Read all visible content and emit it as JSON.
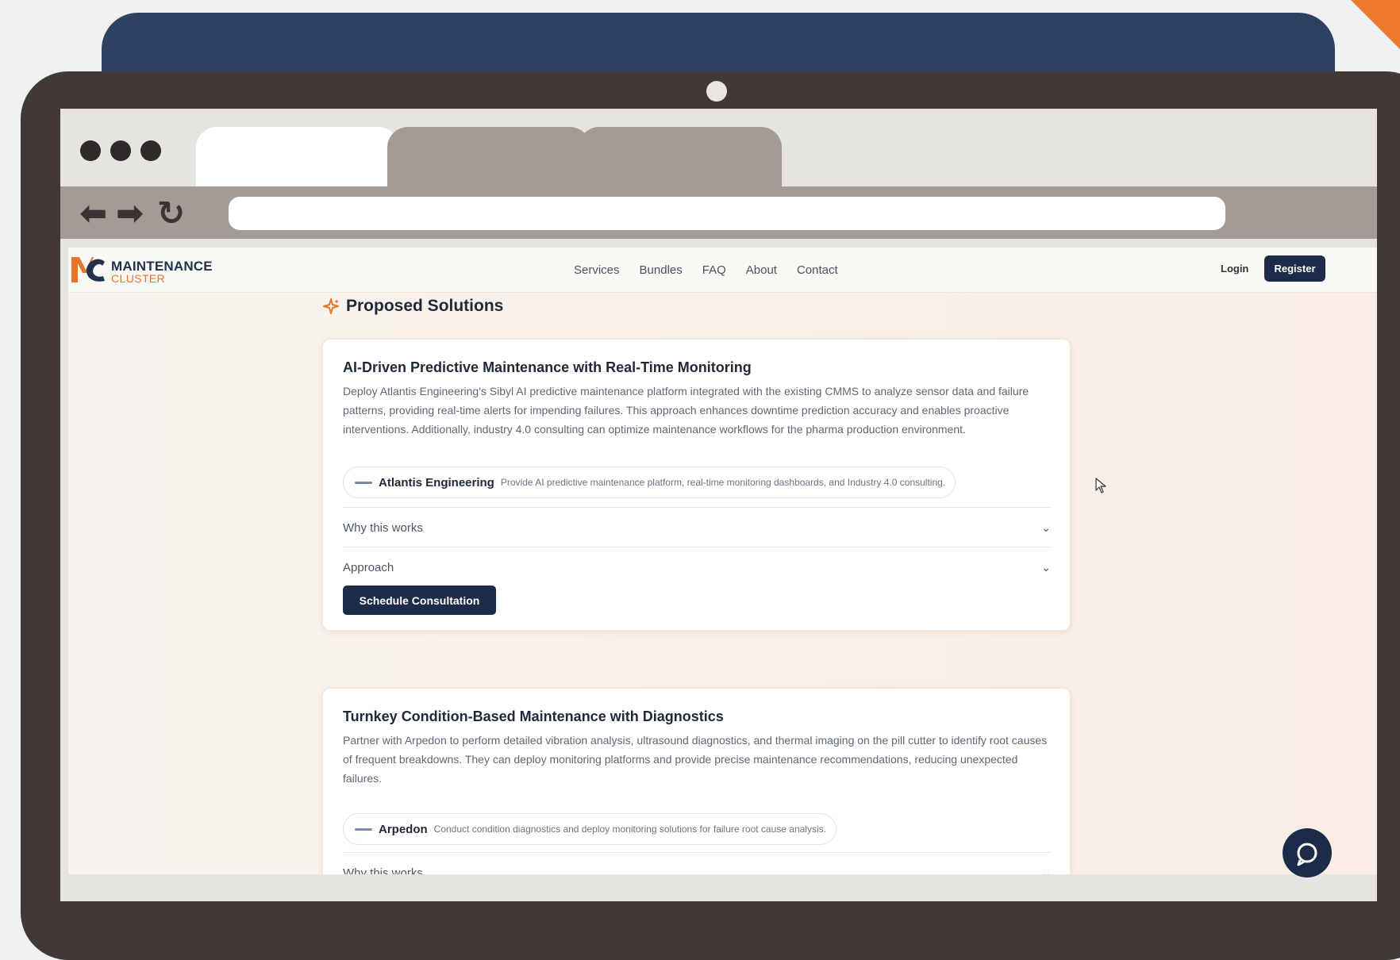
{
  "site": {
    "logo_line1": "MAINTENANCE",
    "logo_line2": "CLUSTER",
    "nav": [
      "Services",
      "Bundles",
      "FAQ",
      "About",
      "Contact"
    ],
    "login_label": "Login",
    "register_label": "Register"
  },
  "section_title": "Proposed Solutions",
  "solutions": [
    {
      "title": "AI-Driven Predictive Maintenance with Real-Time Monitoring",
      "description": "Deploy Atlantis Engineering's Sibyl AI predictive maintenance platform integrated with the existing CMMS to analyze sensor data and failure patterns, providing real-time alerts for impending failures. This approach enhances downtime prediction accuracy and enables proactive interventions. Additionally, industry 4.0 consulting can optimize maintenance workflows for the pharma production environment.",
      "provider_name": "Atlantis Engineering",
      "provider_desc": "Provide AI predictive maintenance platform, real-time monitoring dashboards, and Industry 4.0 consulting.",
      "accordion_1": "Why this works",
      "accordion_2": "Approach",
      "cta": "Schedule Consultation"
    },
    {
      "title": "Turnkey Condition-Based Maintenance with Diagnostics",
      "description": "Partner with Arpedon to perform detailed vibration analysis, ultrasound diagnostics, and thermal imaging on the pill cutter to identify root causes of frequent breakdowns. They can deploy monitoring platforms and provide precise maintenance recommendations, reducing unexpected failures.",
      "provider_name": "Arpedon",
      "provider_desc": "Conduct condition diagnostics and deploy monitoring solutions for failure root cause analysis.",
      "accordion_1": "Why this works"
    }
  ],
  "icons": {
    "sparkle": "sparkle-icon",
    "chevron": "chevron-down-icon",
    "chat": "chat-icon"
  },
  "colors": {
    "navy": "#1c2b48",
    "brand_orange": "#e8732a",
    "frame": "#413838"
  }
}
